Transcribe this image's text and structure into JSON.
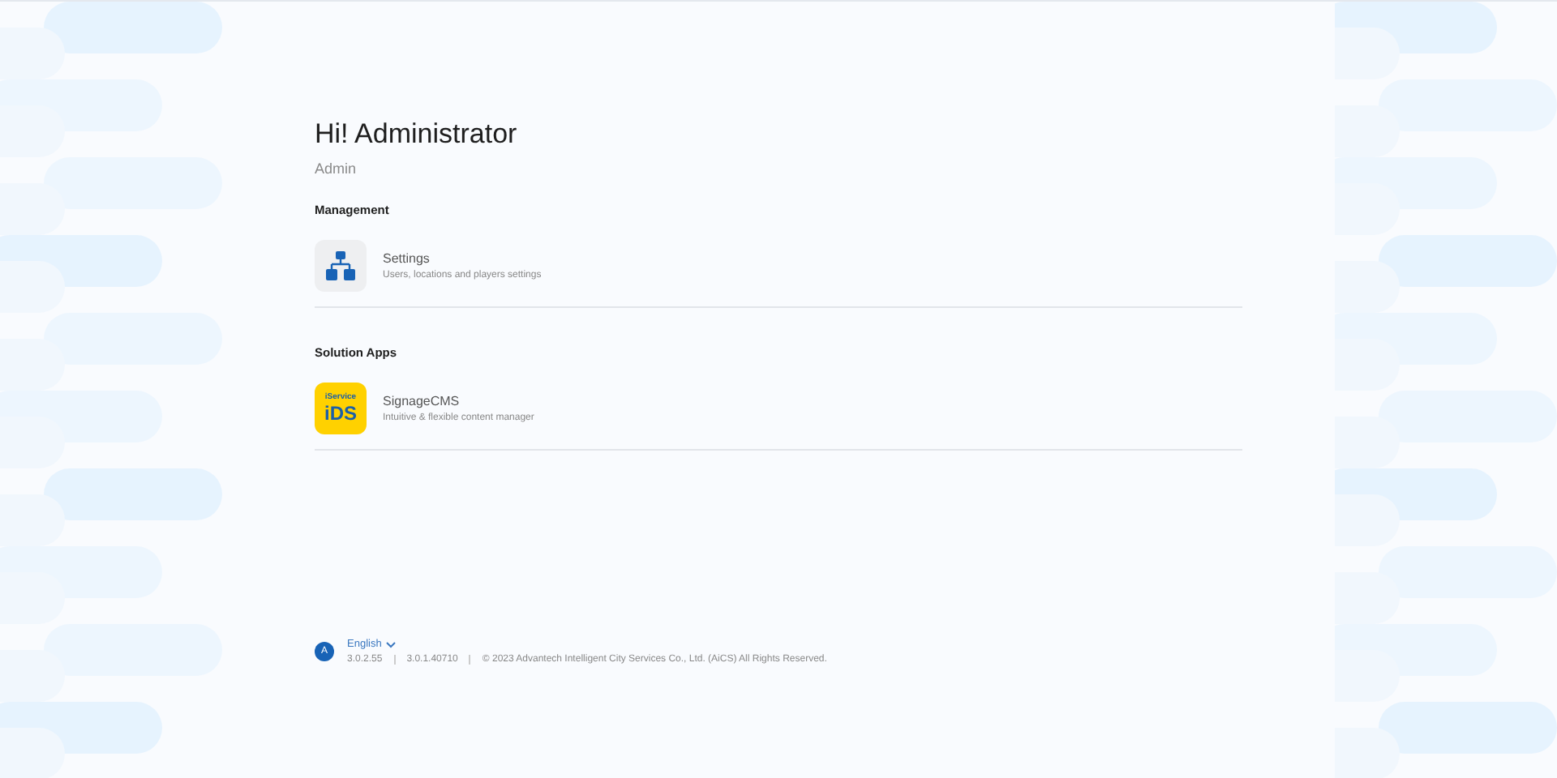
{
  "greeting": {
    "title": "Hi! Administrator",
    "role": "Admin"
  },
  "sections": [
    {
      "heading": "Management",
      "items": [
        {
          "kind": "settings",
          "name": "Settings",
          "description": "Users, locations and players settings"
        }
      ]
    },
    {
      "heading": "Solution Apps",
      "items": [
        {
          "kind": "app",
          "logo_top": "iService",
          "logo_main": "iDS",
          "name": "SignageCMS",
          "description": "Intuitive & flexible content manager"
        }
      ]
    }
  ],
  "footer": {
    "avatar": "A",
    "language": "English",
    "versions": [
      "3.0.2.55",
      "3.0.1.40710",
      "© 2023 Advantech Intelligent City Services Co., Ltd. (AiCS) All Rights Reserved."
    ]
  }
}
